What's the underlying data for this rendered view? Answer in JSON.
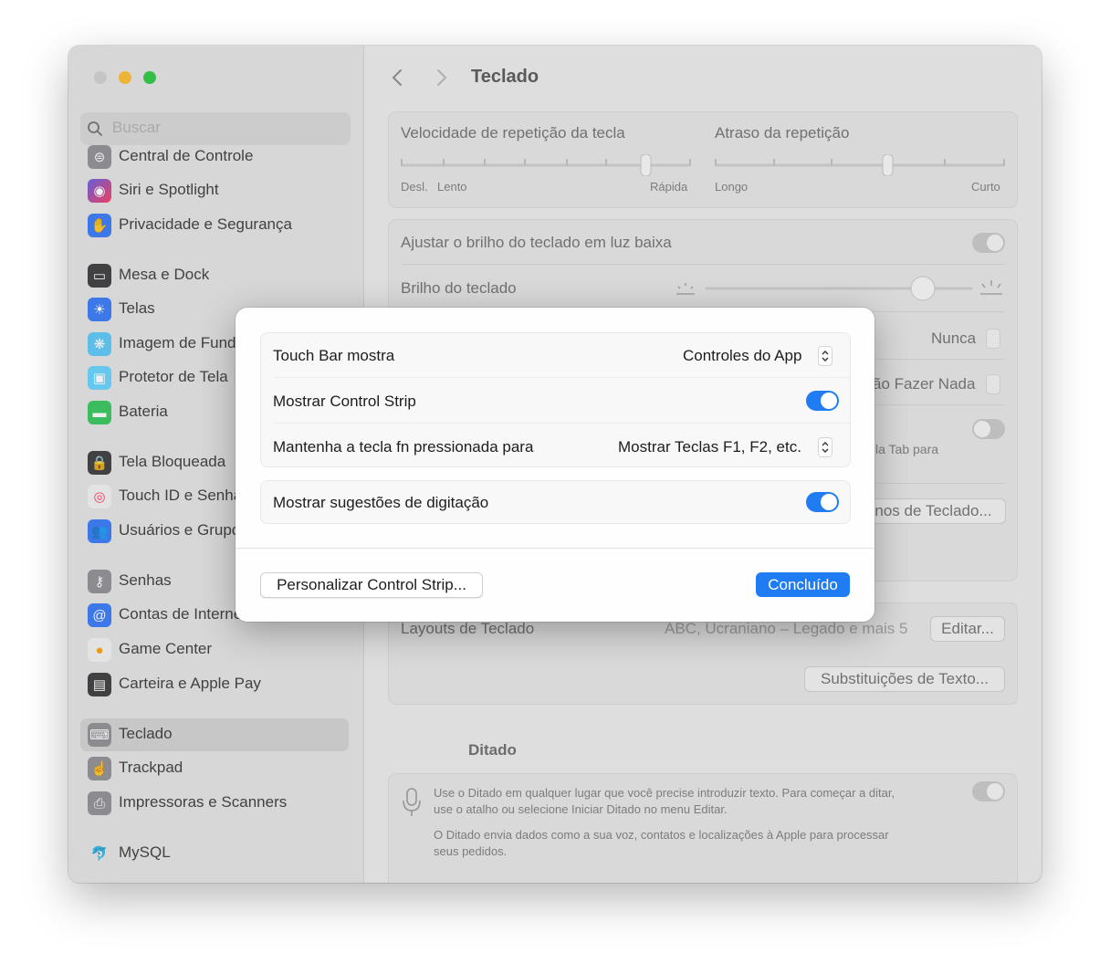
{
  "window": {
    "page_title": "Teclado",
    "search_placeholder": "Buscar"
  },
  "sidebar": {
    "items": [
      {
        "label": "Central de Controle",
        "icon": "control-center-icon",
        "color": "#8e8e93"
      },
      {
        "label": "Siri e Spotlight",
        "icon": "siri-icon",
        "color": "#9b5de5"
      },
      {
        "label": "Privacidade e Segurança",
        "icon": "hand-icon",
        "color": "#3478f6"
      },
      {
        "label": "Mesa e Dock",
        "icon": "dock-icon",
        "color": "#3a3a3c"
      },
      {
        "label": "Telas",
        "icon": "sun-icon",
        "color": "#3478f6"
      },
      {
        "label": "Imagem de Fundo",
        "icon": "wallpaper-icon",
        "color": "#5ac8fa"
      },
      {
        "label": "Protetor de Tela",
        "icon": "screensaver-icon",
        "color": "#64d2ff"
      },
      {
        "label": "Bateria",
        "icon": "battery-icon",
        "color": "#34c759"
      },
      {
        "label": "Tela Bloqueada",
        "icon": "lock-icon",
        "color": "#3a3a3c"
      },
      {
        "label": "Touch ID e Senha",
        "icon": "fingerprint-icon",
        "color": "#ff375f"
      },
      {
        "label": "Usuários e Grupos",
        "icon": "users-icon",
        "color": "#3478f6"
      },
      {
        "label": "Senhas",
        "icon": "key-icon",
        "color": "#8e8e93"
      },
      {
        "label": "Contas de Internet",
        "icon": "at-icon",
        "color": "#3478f6"
      },
      {
        "label": "Game Center",
        "icon": "game-center-icon",
        "color": "#ff9f0a"
      },
      {
        "label": "Carteira e Apple Pay",
        "icon": "wallet-icon",
        "color": "#3a3a3c"
      },
      {
        "label": "Teclado",
        "icon": "keyboard-icon",
        "color": "#8e8e93"
      },
      {
        "label": "Trackpad",
        "icon": "trackpad-icon",
        "color": "#8e8e93"
      },
      {
        "label": "Impressoras e Scanners",
        "icon": "printer-icon",
        "color": "#8e8e93"
      },
      {
        "label": "MySQL",
        "icon": "mysql-icon",
        "color": "#8e8e93"
      }
    ]
  },
  "main": {
    "repeat_speed_label": "Velocidade de repetição da tecla",
    "repeat_speed_off": "Desl.",
    "repeat_speed_slow": "Lento",
    "repeat_speed_fast": "Rápida",
    "repeat_speed_value_fraction": 0.84,
    "repeat_delay_label": "Atraso da repetição",
    "repeat_delay_long": "Longo",
    "repeat_delay_short": "Curto",
    "repeat_delay_value_fraction": 0.6,
    "backlight_label": "Ajustar o brilho do teclado em luz baixa",
    "brightness_label": "Brilho do teclado",
    "brightness_value_fraction": 0.8,
    "backlight_off_value": "Nunca",
    "globe_key_value": "ão Fazer Nada",
    "tab_nav_partial": "la Tab para",
    "shortcuts_button": "nos de Teclado...",
    "layouts_label": "Layouts de Teclado",
    "layouts_value": "ABC, Ucraniano – Legado e mais 5",
    "edit_button": "Editar...",
    "text_replacements_button": "Substituições de Texto...",
    "dictation_heading": "Ditado",
    "dictation_desc1_line1": "Use o Ditado em qualquer lugar que você precise introduzir texto. Para começar a ditar,",
    "dictation_desc1_line2": "use o atalho ou selecione Iniciar Ditado no menu Editar.",
    "dictation_desc2_line1": "O Ditado envia dados como a sua voz, contatos e localizações à Apple para processar",
    "dictation_desc2_line2": "seus pedidos."
  },
  "dialog": {
    "touchbar_label": "Touch Bar mostra",
    "touchbar_value": "Controles do App",
    "control_strip_label": "Mostrar Control Strip",
    "control_strip_on": true,
    "fn_label": "Mantenha a tecla fn pressionada para",
    "fn_value": "Mostrar Teclas F1, F2, etc.",
    "typing_suggestions_label": "Mostrar sugestões de digitação",
    "typing_suggestions_on": true,
    "customize_button": "Personalizar Control Strip...",
    "done_button": "Concluído"
  },
  "colors": {
    "accent": "#1f7cf2",
    "close": "#d0d0d0",
    "minimize": "#febc2e",
    "zoom": "#28c840"
  }
}
